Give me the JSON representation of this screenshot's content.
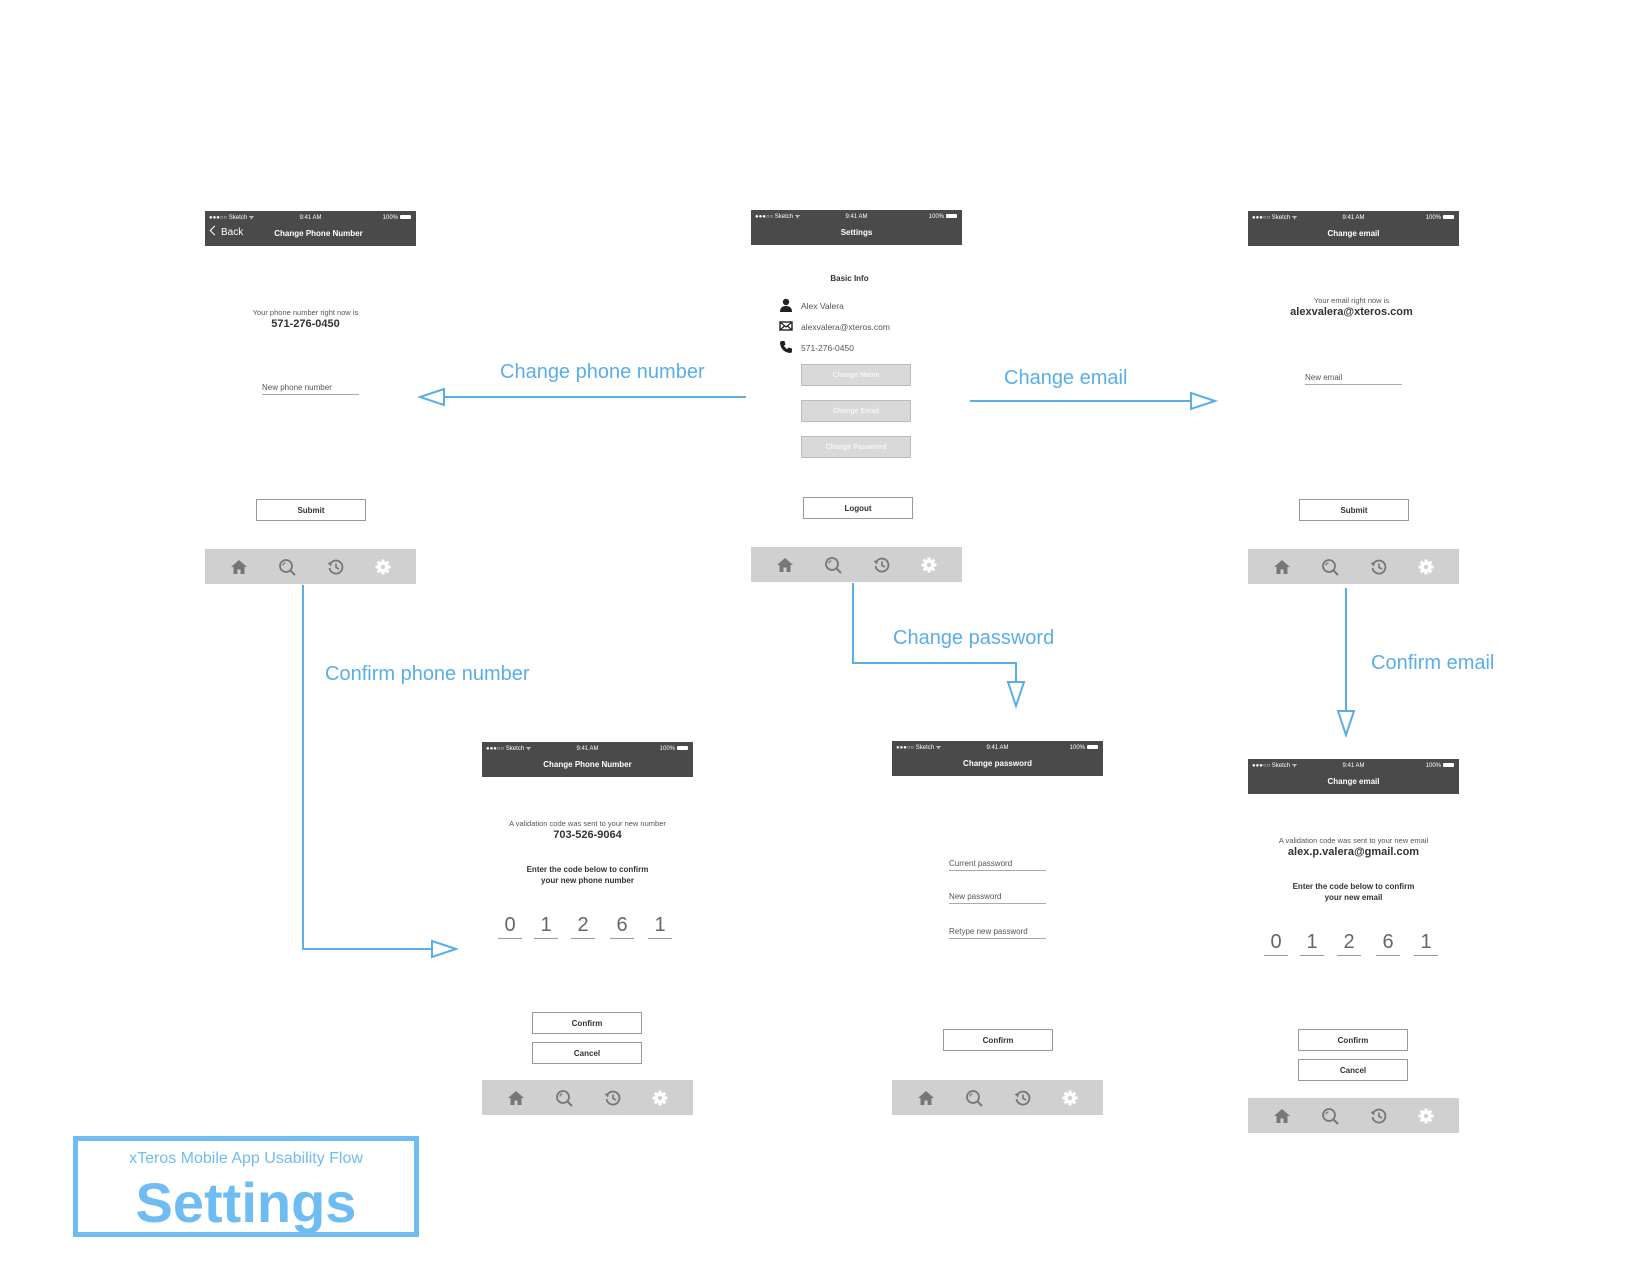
{
  "legend": {
    "subtitle": "xTeros Mobile App Usability Flow",
    "title": "Settings"
  },
  "flows": {
    "change_phone": "Change phone number",
    "change_email": "Change email",
    "change_password": "Change password",
    "confirm_phone": "Confirm phone number",
    "confirm_email": "Confirm email"
  },
  "status": {
    "carrier": "●●●○○ Sketch ᯤ",
    "time": "9:41 AM",
    "battery": "100%"
  },
  "tabbar": {
    "icons": [
      "home-icon",
      "search-icon",
      "history-icon",
      "settings-gear-icon"
    ]
  },
  "screens": {
    "change_phone": {
      "back": "Back",
      "title": "Change Phone Number",
      "current_label": "Your phone number right now is",
      "current_value": "571-276-0450",
      "new_field": "New phone number",
      "submit": "Submit"
    },
    "settings": {
      "title": "Settings",
      "section": "Basic Info",
      "name": "Alex Valera",
      "email": "alexvalera@xteros.com",
      "phone": "571-276-0450",
      "btn_name": "Change Name",
      "btn_email": "Change Email",
      "btn_password": "Change Password",
      "logout": "Logout"
    },
    "change_email": {
      "title": "Change email",
      "current_label": "Your email right now is",
      "current_value": "alexvalera@xteros.com",
      "new_field": "New email",
      "submit": "Submit"
    },
    "confirm_phone": {
      "title": "Change Phone Number",
      "sent_label": "A validation code was sent to your new number",
      "sent_value": "703-526-9064",
      "instruction_1": "Enter the code below to confirm",
      "instruction_2": "your new phone number",
      "code": [
        "0",
        "1",
        "2",
        "6",
        "1"
      ],
      "confirm": "Confirm",
      "cancel": "Cancel"
    },
    "change_password": {
      "title": "Change password",
      "current": "Current password",
      "new": "New password",
      "retype": "Retype new password",
      "confirm": "Confirm"
    },
    "confirm_email": {
      "title": "Change email",
      "sent_label": "A validation code was sent to your new email",
      "sent_value": "alex.p.valera@gmail.com",
      "instruction_1": "Enter the code below to confirm",
      "instruction_2": "your new email",
      "code": [
        "0",
        "1",
        "2",
        "6",
        "1"
      ],
      "confirm": "Confirm",
      "cancel": "Cancel"
    }
  }
}
